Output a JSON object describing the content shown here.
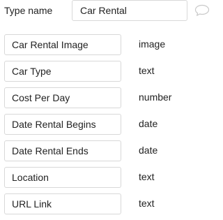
{
  "type_name": {
    "label": "Type name",
    "value": "Car Rental"
  },
  "icons": {
    "comment": "comment-icon"
  },
  "fields": [
    {
      "name": "Car Rental Image",
      "type": "image"
    },
    {
      "name": "Car Type",
      "type": "text"
    },
    {
      "name": "Cost Per Day",
      "type": "number"
    },
    {
      "name": "Date Rental Begins",
      "type": "date"
    },
    {
      "name": "Date Rental Ends",
      "type": "date"
    },
    {
      "name": "Location",
      "type": "text"
    },
    {
      "name": "URL Link",
      "type": "text"
    }
  ]
}
